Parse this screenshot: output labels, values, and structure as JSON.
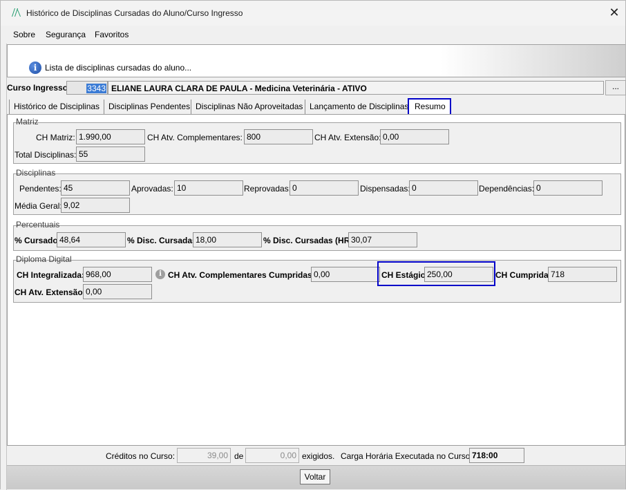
{
  "window": {
    "title": "Histórico de Disciplinas Cursadas do Aluno/Curso Ingresso",
    "close": "✕"
  },
  "menu": [
    "Sobre",
    "Segurança",
    "Favoritos"
  ],
  "banner": {
    "text": "Lista de disciplinas cursadas do aluno..."
  },
  "course": {
    "label": "Curso Ingresso:",
    "code": "3343",
    "name": "ELIANE LAURA CLARA DE PAULA - Medicina Veterinária - ATIVO",
    "button": "..."
  },
  "tabs": [
    "Histórico de Disciplinas",
    "Disciplinas Pendentes",
    "Disciplinas Não Aproveitadas",
    "Lançamento de Disciplinas",
    "Resumo"
  ],
  "matriz": {
    "title": "Matriz",
    "ch_matriz_label": "CH Matriz:",
    "ch_matriz": "1.990,00",
    "ch_atv_comp_label": "CH Atv. Complementares:",
    "ch_atv_comp": "800",
    "ch_atv_ext_label": "CH Atv. Extensão:",
    "ch_atv_ext": "0,00",
    "total_label": "Total Disciplinas:",
    "total": "55"
  },
  "disciplinas": {
    "title": "Disciplinas",
    "pendentes_label": "Pendentes:",
    "pendentes": "45",
    "aprovadas_label": "Aprovadas:",
    "aprovadas": "10",
    "reprovadas_label": "Reprovadas:",
    "reprovadas": "0",
    "dispensadas_label": "Dispensadas:",
    "dispensadas": "0",
    "dependencias_label": "Dependências:",
    "dependencias": "0",
    "media_label": "Média Geral:",
    "media": "9,02"
  },
  "percentuais": {
    "title": "Percentuais",
    "cursado_label": "% Cursado:",
    "cursado": "48,64",
    "disc_cursadas_label": "% Disc. Cursadas:",
    "disc_cursadas": "18,00",
    "disc_cursadas_hr_label": "% Disc. Cursadas (HR):",
    "disc_cursadas_hr": "30,07"
  },
  "diploma": {
    "title": "Diploma Digital",
    "ch_integralizada_label": "CH Integralizada:",
    "ch_integralizada": "968,00",
    "ch_atv_comp_cumpridas_label": "CH Atv. Complementares Cumpridas:",
    "ch_atv_comp_cumpridas": "0,00",
    "ch_estagio_label": "CH Estágio:",
    "ch_estagio": "250,00",
    "ch_cumprida_label": "CH Cumprida:",
    "ch_cumprida": "718",
    "ch_atv_ext_label": "CH Atv. Extensão:",
    "ch_atv_ext": "0,00"
  },
  "footer": {
    "creditos_label": "Créditos no Curso:",
    "creditos": "39,00",
    "de_label": "de",
    "exigidos": "0,00",
    "exigidos_label": "exigidos.",
    "carga_label": "Carga Horária Executada no Curso:",
    "carga": "718:00"
  },
  "buttons": {
    "voltar": "Voltar"
  },
  "colors": {
    "highlight": "#0000c8",
    "selection": "#3a7bd5"
  },
  "icons": [
    "app-logo-icon",
    "info-icon",
    "info-small-icon",
    "close-icon"
  ]
}
